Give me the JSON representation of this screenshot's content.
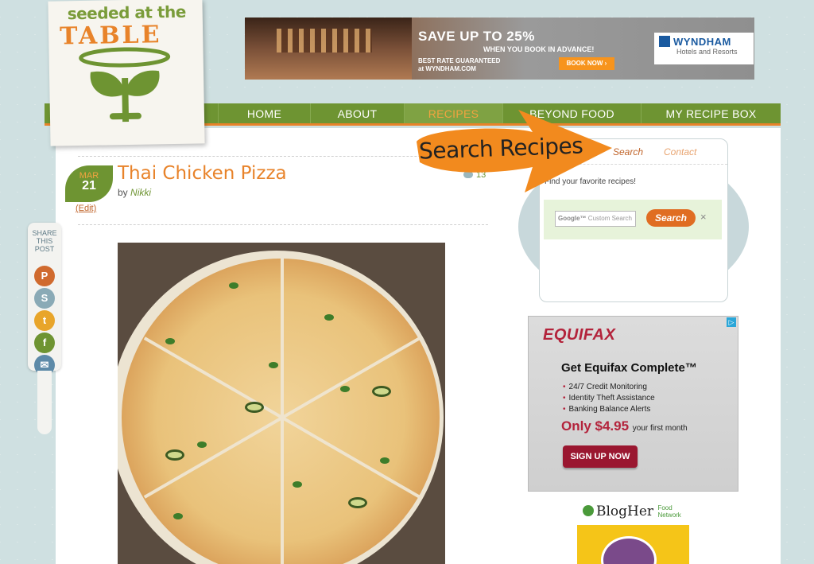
{
  "logo": {
    "line1": "seeded at the",
    "line2": "TABLE"
  },
  "top_ad": {
    "headline": "SAVE UP TO 25%",
    "subline": "WHEN YOU BOOK IN ADVANCE!",
    "best_line1": "BEST RATE GUARANTEED",
    "best_line2": "at WYNDHAM.COM",
    "cta": "BOOK NOW ›",
    "brand": "WYNDHAM",
    "brand_sub": "Hotels and Resorts"
  },
  "nav": {
    "items": [
      {
        "label": "HOME"
      },
      {
        "label": "ABOUT"
      },
      {
        "label": "RECIPES"
      },
      {
        "label": "BEYOND FOOD"
      },
      {
        "label": "MY RECIPE BOX"
      }
    ],
    "active": "RECIPES"
  },
  "post": {
    "month": "MAR",
    "day": "21",
    "edit": "(Edit)",
    "title": "Thai Chicken Pizza",
    "by": "by",
    "author": "Nikki",
    "comment_count": "13"
  },
  "share": {
    "label_lines": [
      "SHARE",
      "THIS",
      "POST"
    ]
  },
  "annotation": {
    "text": "Search Recipes"
  },
  "search_panel": {
    "tab_search": "Search",
    "tab_contact": "Contact",
    "prompt": "Find your favorite recipes!",
    "input_placeholder_brand": "Google™",
    "input_placeholder": "Custom Search",
    "button": "Search",
    "clear": "×"
  },
  "equifax_ad": {
    "logo": "EQUIFAX",
    "headline": "Get Equifax Complete™",
    "bullets": [
      "24/7 Credit Monitoring",
      "Identity Theft Assistance",
      "Banking Balance Alerts"
    ],
    "price": "Only $4.95",
    "price_sub": "your first month",
    "cta": "SIGN UP NOW",
    "adchoices": "▷"
  },
  "blogher": {
    "name": "BlogHer",
    "sub_line1": "Food",
    "sub_line2": "Network"
  },
  "colors": {
    "green": "#6e9432",
    "orange": "#e8832a",
    "background": "#cfe0e1"
  }
}
